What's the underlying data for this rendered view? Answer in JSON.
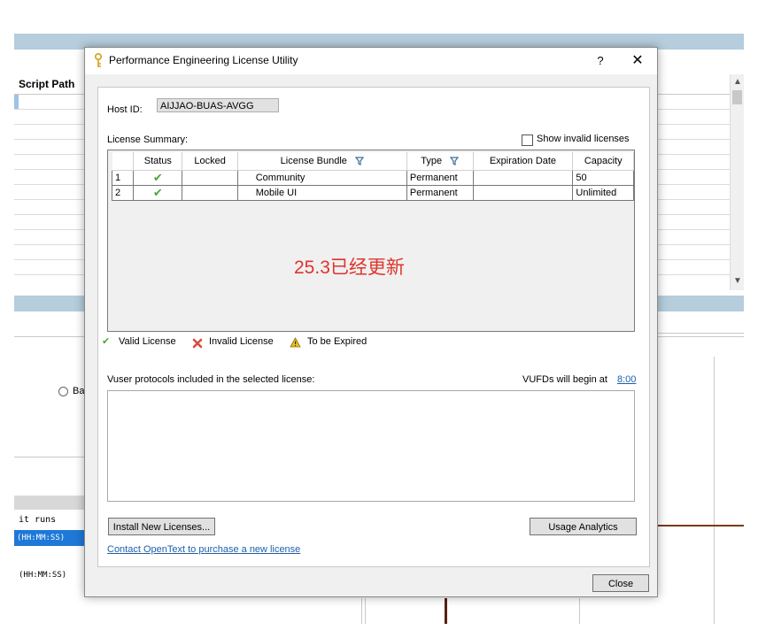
{
  "background": {
    "column_header": "Script Path",
    "radio_label": "Ba",
    "runs_label": "it runs",
    "time_format_selected": "(HH:MM:SS)",
    "time_format_2": "(HH:MM:SS)"
  },
  "dialog": {
    "title": "Performance Engineering License Utility",
    "help_label": "?",
    "close_icon_label": "✕",
    "host_id_label": "Host ID:",
    "host_id_value": "AIJJAO-BUAS-AVGG",
    "license_summary_label": "License Summary:",
    "show_invalid_label": "Show invalid licenses",
    "show_invalid_checked": false,
    "table": {
      "columns": [
        "",
        "Status",
        "Locked",
        "License Bundle",
        "Type",
        "Expiration Date",
        "Capacity"
      ],
      "rows": [
        {
          "num": "1",
          "status": "valid",
          "locked": "",
          "bundle": "Community",
          "type": "Permanent",
          "expiration": "",
          "capacity": "50"
        },
        {
          "num": "2",
          "status": "valid",
          "locked": "",
          "bundle": "Mobile UI",
          "type": "Permanent",
          "expiration": "",
          "capacity": "Unlimited"
        }
      ]
    },
    "overlay_text": "25.3已经更新",
    "legend": {
      "valid": "Valid License",
      "invalid": "Invalid License",
      "expiring": "To be Expired"
    },
    "protocols_label": "Vuser protocols included in the selected license:",
    "vufds_label": "VUFDs will begin at",
    "vufds_time": "8:00",
    "install_button": "Install New Licenses...",
    "usage_button": "Usage Analytics",
    "contact_link": "Contact OpenText to purchase a new license",
    "close_button": "Close"
  },
  "colors": {
    "valid_check": "#4aa832",
    "invalid_x": "#d94a3d",
    "warning": "#e8c020",
    "overlay_text": "#e0342c",
    "link": "#1f5fa8",
    "band": "#b5cddc"
  }
}
